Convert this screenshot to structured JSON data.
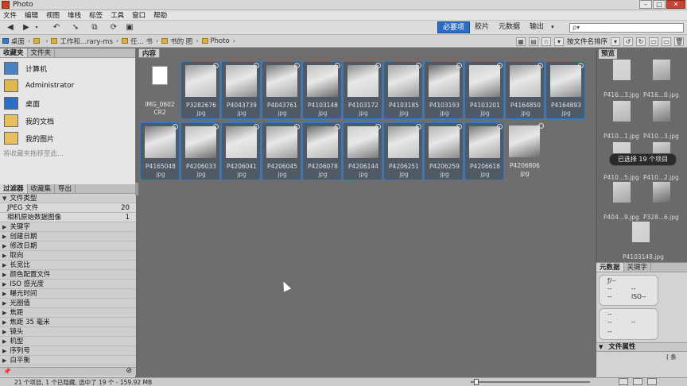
{
  "window": {
    "title": "Photo"
  },
  "menu": [
    "文件",
    "编辑",
    "视图",
    "堆栈",
    "标签",
    "工具",
    "窗口",
    "帮助"
  ],
  "workspace": {
    "tabs": [
      {
        "label": "必要项",
        "active": true
      },
      {
        "label": "胶片",
        "active": false
      },
      {
        "label": "元数据",
        "active": false
      },
      {
        "label": "输出",
        "active": false
      }
    ],
    "search_placeholder": "ρ▾"
  },
  "breadcrumb": [
    {
      "label": "桌面"
    },
    {
      "label": ""
    },
    {
      "label": "工作和...rary-ms"
    },
    {
      "label": "任... 书"
    },
    {
      "label": "书的 图"
    },
    {
      "label": "Photo"
    }
  ],
  "path_tools": {
    "sort_label": "按文件名排序"
  },
  "left_tabs": [
    {
      "label": "收藏夹",
      "active": true
    },
    {
      "label": "文件夹",
      "active": false
    }
  ],
  "favorites": [
    {
      "label": "计算机",
      "icon": "computer-icon"
    },
    {
      "label": "Administrator",
      "icon": "user-folder-icon"
    },
    {
      "label": "桌面",
      "icon": "desktop-icon"
    },
    {
      "label": "我的文档",
      "icon": "folder-icon"
    },
    {
      "label": "我的图片",
      "icon": "folder-icon"
    }
  ],
  "fav_hint": "将收藏夹拖移至此...",
  "filter_tabs": [
    {
      "label": "过滤器",
      "active": true
    },
    {
      "label": "收藏集",
      "active": false
    },
    {
      "label": "导出",
      "active": false
    }
  ],
  "filters": [
    {
      "label": "文件类型",
      "expanded": true
    },
    {
      "label": "JPEG 文件",
      "count": "20",
      "sub": true
    },
    {
      "label": "相机原始数据图像",
      "count": "1",
      "sub": true
    },
    {
      "label": "关键字",
      "expanded": false
    },
    {
      "label": "创建日期",
      "expanded": false
    },
    {
      "label": "修改日期",
      "expanded": false
    },
    {
      "label": "取向",
      "expanded": false
    },
    {
      "label": "长宽比",
      "expanded": false
    },
    {
      "label": "颜色配置文件",
      "expanded": false
    },
    {
      "label": "ISO 感光度",
      "expanded": false
    },
    {
      "label": "曝光时间",
      "expanded": false
    },
    {
      "label": "光圈值",
      "expanded": false
    },
    {
      "label": "焦距",
      "expanded": false
    },
    {
      "label": "焦距 35 毫米",
      "expanded": false
    },
    {
      "label": "镜头",
      "expanded": false
    },
    {
      "label": "机型",
      "expanded": false
    },
    {
      "label": "序列号",
      "expanded": false
    },
    {
      "label": "白平衡",
      "expanded": false
    }
  ],
  "content": {
    "tab_label": "内容",
    "files": [
      {
        "name": "IMG_0602",
        "ext": "CR2",
        "selected": false
      },
      {
        "name": "P3282676",
        "ext": "jpg",
        "selected": true
      },
      {
        "name": "P4043739",
        "ext": "jpg",
        "selected": true
      },
      {
        "name": "P4043761",
        "ext": "jpg",
        "selected": true
      },
      {
        "name": "P4103148",
        "ext": "jpg",
        "selected": true
      },
      {
        "name": "P4103172",
        "ext": "jpg",
        "selected": true
      },
      {
        "name": "P4103185",
        "ext": "jpg",
        "selected": true
      },
      {
        "name": "P4103193",
        "ext": "jpg",
        "selected": true
      },
      {
        "name": "P4103201",
        "ext": "jpg",
        "selected": true
      },
      {
        "name": "P4164850",
        "ext": "jpg",
        "selected": true
      },
      {
        "name": "P4164893",
        "ext": "jpg",
        "selected": true
      },
      {
        "name": "P4165048",
        "ext": "jpg",
        "selected": true
      },
      {
        "name": "P4206033",
        "ext": "jpg",
        "selected": true
      },
      {
        "name": "P4206041",
        "ext": "jpg",
        "selected": true
      },
      {
        "name": "P4206045",
        "ext": "jpg",
        "selected": true
      },
      {
        "name": "P4206078",
        "ext": "jpg",
        "selected": true
      },
      {
        "name": "P4206144",
        "ext": "jpg",
        "selected": true
      },
      {
        "name": "P4206251",
        "ext": "jpg",
        "selected": true
      },
      {
        "name": "P4206259",
        "ext": "jpg",
        "selected": true
      },
      {
        "name": "P4206618",
        "ext": "jpg",
        "selected": true
      },
      {
        "name": "P4206806",
        "ext": "jpg",
        "selected": false
      }
    ]
  },
  "preview": {
    "tab_label": "预览",
    "labels": [
      "P416...3.jpg",
      "P416...0.jpg",
      "P410...1.jpg",
      "P410...3.jpg",
      "P410...5.jpg",
      "P410...2.jpg",
      "P404...9.jpg",
      "P328...6.jpg",
      "P4103148.jpg"
    ],
    "tooltip": "已选择 19 个项目"
  },
  "metadata": {
    "tabs": [
      {
        "label": "元数据",
        "active": true
      },
      {
        "label": "关键字",
        "active": false
      }
    ],
    "box1": [
      "ƒ/--",
      "--",
      "--",
      "--",
      "ISO--"
    ],
    "box2": [
      "--",
      "--",
      "--",
      "--"
    ],
    "file_attr_label": "文件属性",
    "side_text": "( 条"
  },
  "status": {
    "text": "21 个项目, 1 个已隐藏, 选中了 19 个 - 159.92 MB"
  },
  "colors": {
    "accent": "#2d6cc4",
    "selection_border": "#2a7bd0",
    "content_bg": "#6e6e6e"
  }
}
